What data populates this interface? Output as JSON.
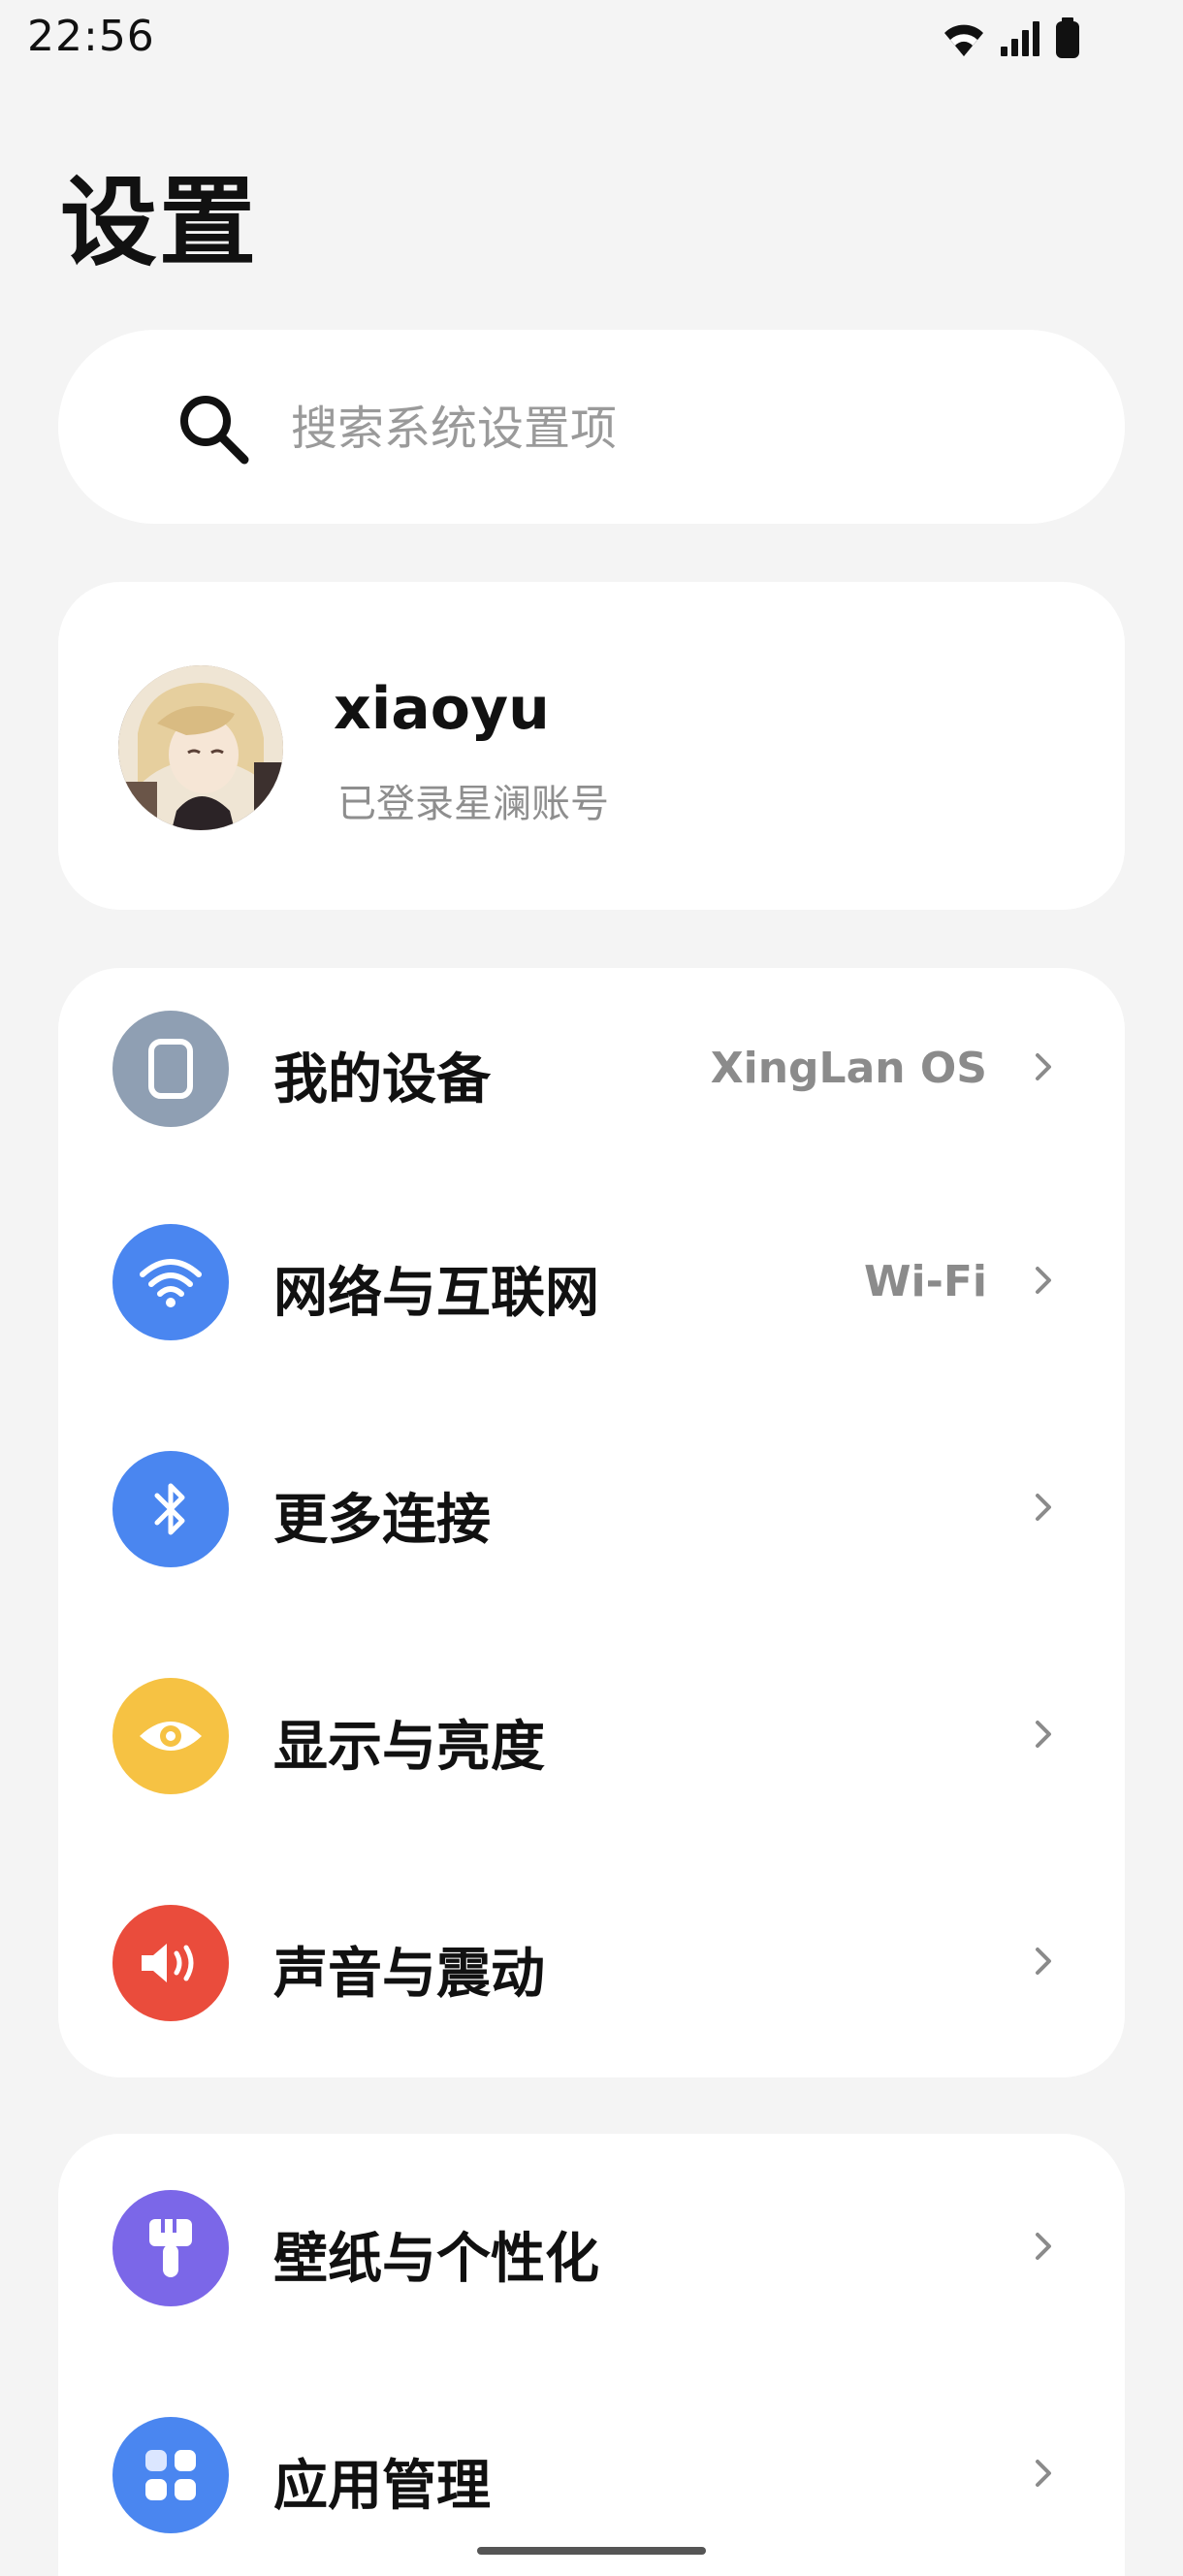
{
  "status_bar": {
    "time": "22:56"
  },
  "header": {
    "title": "设置"
  },
  "search": {
    "placeholder": "搜索系统设置项"
  },
  "account": {
    "name": "xiaoyu",
    "subtitle": "已登录星澜账号"
  },
  "groups": [
    {
      "items": [
        {
          "label": "我的设备",
          "value": "XingLan OS",
          "icon": "device-icon",
          "color": "#8f9fb3"
        },
        {
          "label": "网络与互联网",
          "value": "Wi-Fi",
          "icon": "wifi-icon",
          "color": "#4a86f0"
        },
        {
          "label": "更多连接",
          "value": "",
          "icon": "bluetooth-icon",
          "color": "#4a86f0"
        },
        {
          "label": "显示与亮度",
          "value": "",
          "icon": "eye-icon",
          "color": "#f6c243"
        },
        {
          "label": "声音与震动",
          "value": "",
          "icon": "speaker-icon",
          "color": "#ea4c3c"
        }
      ]
    },
    {
      "items": [
        {
          "label": "壁纸与个性化",
          "value": "",
          "icon": "brush-icon",
          "color": "#7b67e8"
        },
        {
          "label": "应用管理",
          "value": "",
          "icon": "apps-icon",
          "color": "#4a86f0"
        }
      ]
    }
  ]
}
